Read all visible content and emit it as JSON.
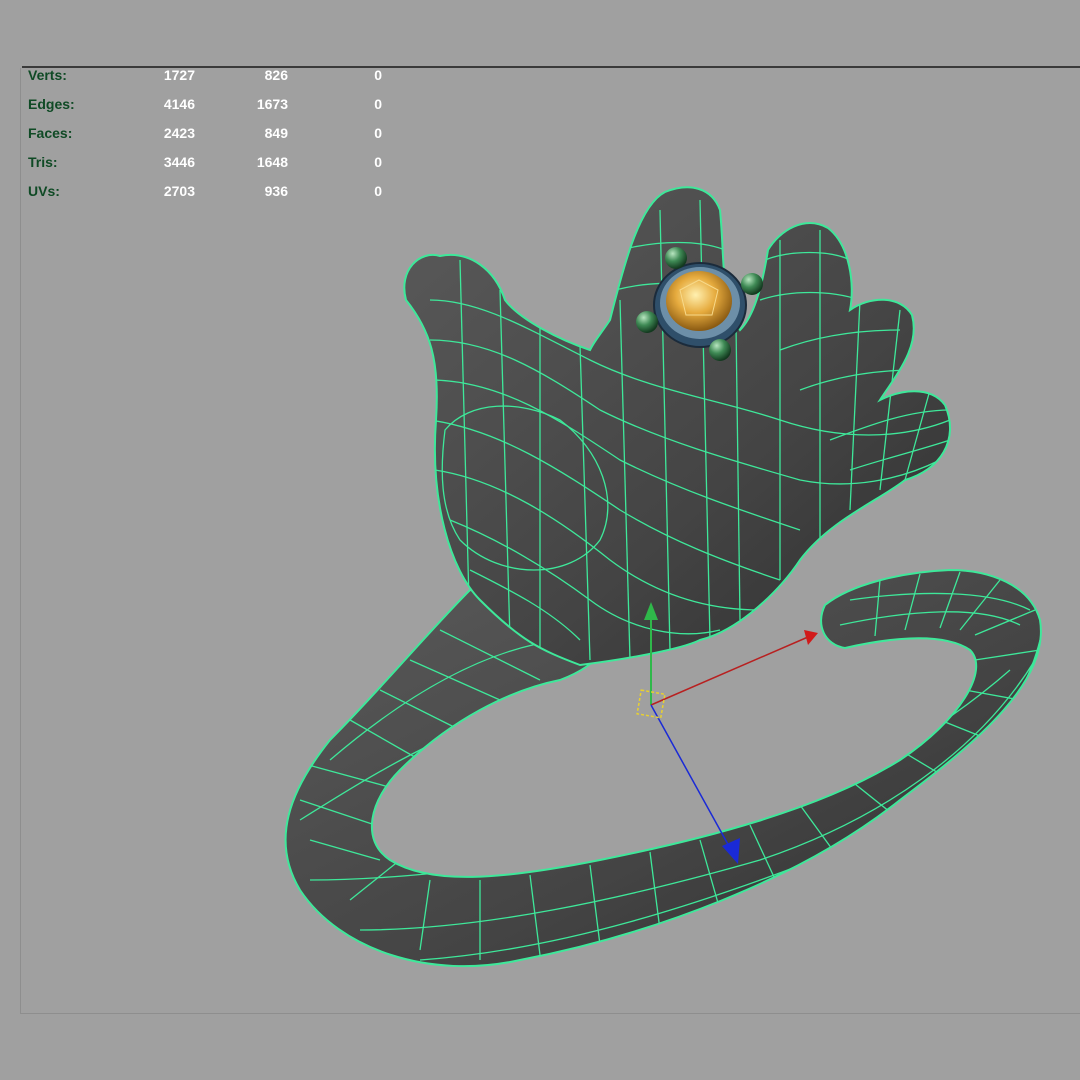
{
  "hud": {
    "rows": [
      {
        "label": "Verts:",
        "values": [
          "1727",
          "826",
          "0"
        ]
      },
      {
        "label": "Edges:",
        "values": [
          "4146",
          "1673",
          "0"
        ]
      },
      {
        "label": "Faces:",
        "values": [
          "2423",
          "849",
          "0"
        ]
      },
      {
        "label": "Tris:",
        "values": [
          "3446",
          "1648",
          "0"
        ]
      },
      {
        "label": "UVs:",
        "values": [
          "2703",
          "936",
          "0"
        ]
      }
    ]
  },
  "colors": {
    "viewport_bg": "#a0a0a0",
    "wireframe": "#3ee89a",
    "mesh": "#4a4a4a",
    "hud_label": "#0f4a25",
    "hud_value": "#ffffff",
    "gem": "#e0a53a",
    "manipulator_y": "#2fb84a",
    "manipulator_x": "#d11a1a",
    "manipulator_z": "#1a2ad6"
  },
  "icons": [
    "move-manipulator-icon",
    "pivot-icon"
  ]
}
